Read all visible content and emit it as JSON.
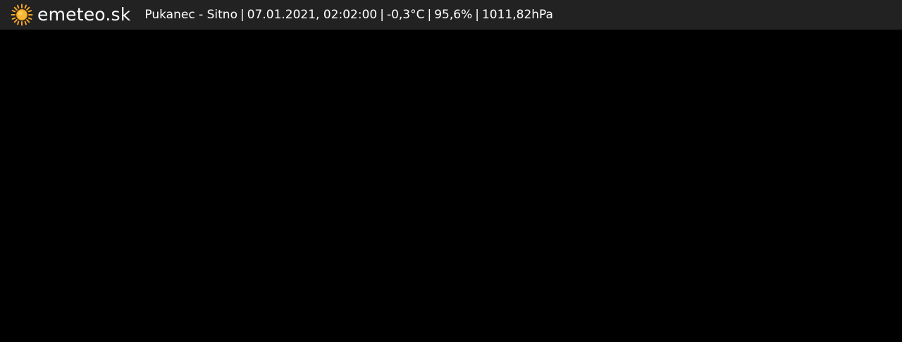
{
  "logo": {
    "text": "emeteo.sk",
    "icon": "sun-icon",
    "icon_color": "#f5a623"
  },
  "info": {
    "location": "Pukanec - Sitno",
    "datetime": "07.01.2021, 02:02:00",
    "temperature": "-0,3°C",
    "humidity": "95,6%",
    "pressure": "1011,82hPa",
    "separator": "|"
  },
  "colors": {
    "bar_background": "#222222",
    "image_background": "#000000",
    "text": "#ffffff"
  }
}
